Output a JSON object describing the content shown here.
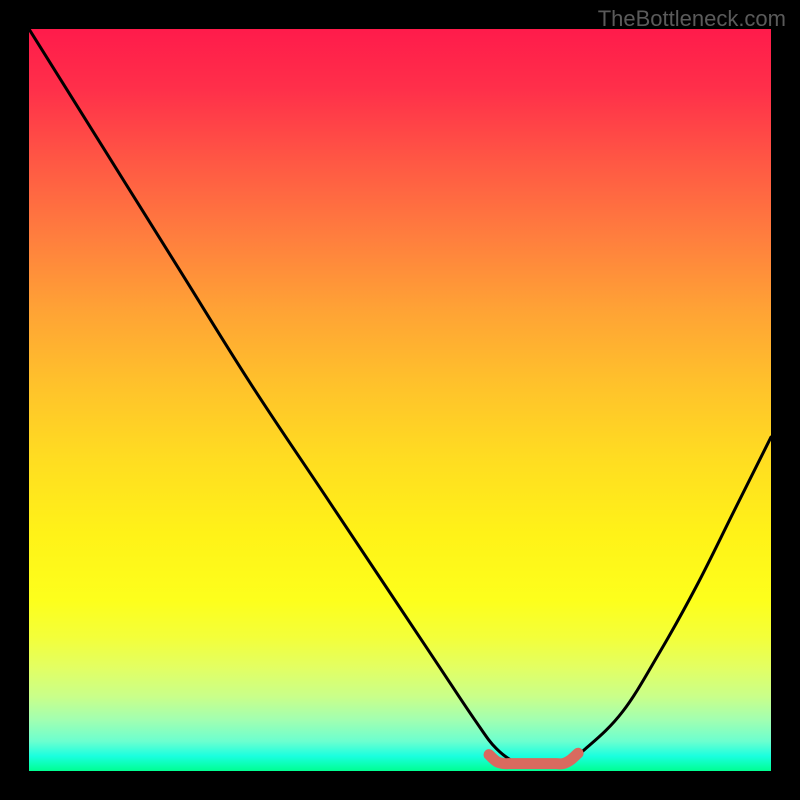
{
  "watermark": "TheBottleneck.com",
  "chart_data": {
    "type": "line",
    "title": "",
    "xlabel": "",
    "ylabel": "",
    "xlim": [
      0,
      100
    ],
    "ylim": [
      0,
      100
    ],
    "series": [
      {
        "name": "bottleneck-curve",
        "x": [
          0,
          10,
          20,
          30,
          40,
          50,
          55,
          60,
          63,
          66,
          69,
          72,
          75,
          80,
          85,
          90,
          95,
          100
        ],
        "values": [
          100,
          84,
          68,
          52,
          37,
          22,
          14.5,
          7,
          3,
          1,
          1,
          1,
          3,
          8,
          16,
          25,
          35,
          45
        ]
      },
      {
        "name": "optimal-marker",
        "x": [
          62,
          63,
          64,
          65,
          66,
          67,
          68,
          69,
          70,
          71,
          72,
          73,
          74
        ],
        "values": [
          2.2,
          1.3,
          1.0,
          1.0,
          1.0,
          1.0,
          1.0,
          1.0,
          1.0,
          1.0,
          1.0,
          1.5,
          2.4
        ]
      }
    ],
    "colors": {
      "curve": "#000000",
      "marker": "#d96a5f"
    }
  }
}
